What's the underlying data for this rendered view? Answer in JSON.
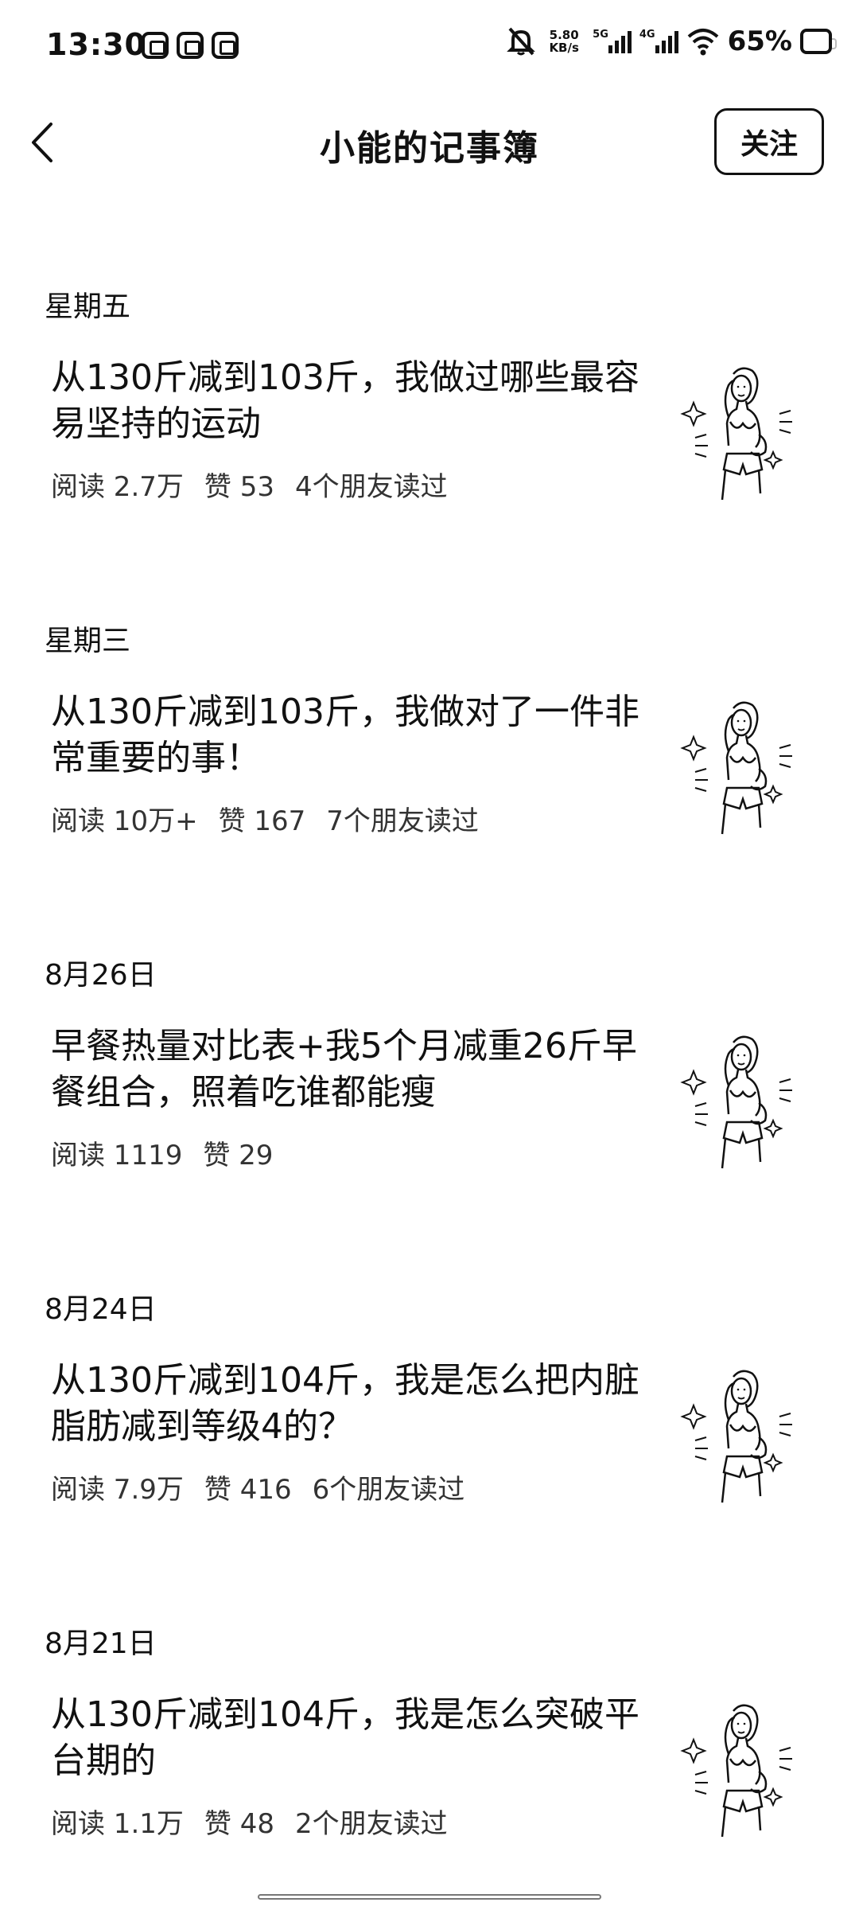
{
  "status_bar": {
    "time": "13:30",
    "speed_value": "5.80",
    "speed_unit": "KB/s",
    "net1": "5G",
    "net2": "4G",
    "battery": "65%"
  },
  "header": {
    "title": "小能的记事簿",
    "follow_label": "关注"
  },
  "entries": [
    {
      "date": "星期五",
      "title": "从130斤减到103斤，我做过哪些最容易坚持的运动",
      "reads": "阅读 2.7万",
      "likes": "赞 53",
      "friends": "4个朋友读过"
    },
    {
      "date": "星期三",
      "title": "从130斤减到103斤，我做对了一件非常重要的事！",
      "reads": "阅读 10万+",
      "likes": "赞 167",
      "friends": "7个朋友读过"
    },
    {
      "date": "8月26日",
      "title": "早餐热量对比表+我5个月减重26斤早餐组合，照着吃谁都能瘦",
      "reads": "阅读 1119",
      "likes": "赞 29",
      "friends": ""
    },
    {
      "date": "8月24日",
      "title": "从130斤减到104斤，我是怎么把内脏脂肪减到等级4的？",
      "reads": "阅读 7.9万",
      "likes": "赞 416",
      "friends": "6个朋友读过"
    },
    {
      "date": "8月21日",
      "title": "从130斤减到104斤，我是怎么突破平台期的",
      "reads": "阅读 1.1万",
      "likes": "赞 48",
      "friends": "2个朋友读过"
    }
  ]
}
